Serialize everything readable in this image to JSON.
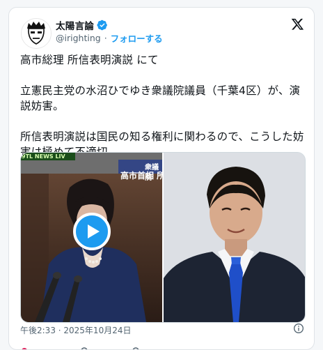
{
  "author": {
    "display_name": "太陽言論",
    "handle": "@irighting",
    "separator": "·",
    "follow_label": "フォローする"
  },
  "tweet": {
    "line1": "高市総理 所信表明演説 にて",
    "line2": "立憲民主党の水沼ひでゆき衆議院議員（千葉4区）が、演説妨害。",
    "line3": "所信表明演説は国民の知る権利に関わるので、こうした妨害は極めて不適切。",
    "timestamp": "午後2:33 · 2025年10月24日"
  },
  "media": {
    "tv_tag": "9TL NEWS LIV",
    "tv_chamber": "衆議院",
    "tv_caption": "高市首相 所"
  },
  "colors": {
    "accent": "#1d9bf0",
    "text": "#0f1419",
    "secondary": "#536471"
  },
  "icons": [
    "verified-badge-icon",
    "x-logo-icon",
    "play-icon",
    "info-icon"
  ]
}
